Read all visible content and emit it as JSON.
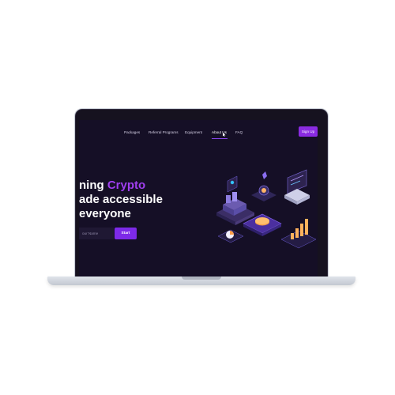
{
  "nav": {
    "items": [
      {
        "label": "Packages",
        "active": false
      },
      {
        "label": "Referral Programs",
        "active": false
      },
      {
        "label": "Equipment",
        "active": false
      },
      {
        "label": "About Us",
        "active": true
      },
      {
        "label": "FAQ",
        "active": false
      }
    ],
    "signup_label": "Sign Up"
  },
  "hero": {
    "line1_plain": "ning ",
    "line1_accent": "Crypto",
    "line2": "ade accessible",
    "line3": "everyone"
  },
  "form": {
    "name_placeholder": "our Name",
    "start_label": "Start"
  },
  "colors": {
    "accent": "#a03ff0",
    "button": "#7d2ae8",
    "screen_bg": "#150f26"
  },
  "icons": [
    "cursor-icon",
    "isometric-crypto-illustration"
  ]
}
